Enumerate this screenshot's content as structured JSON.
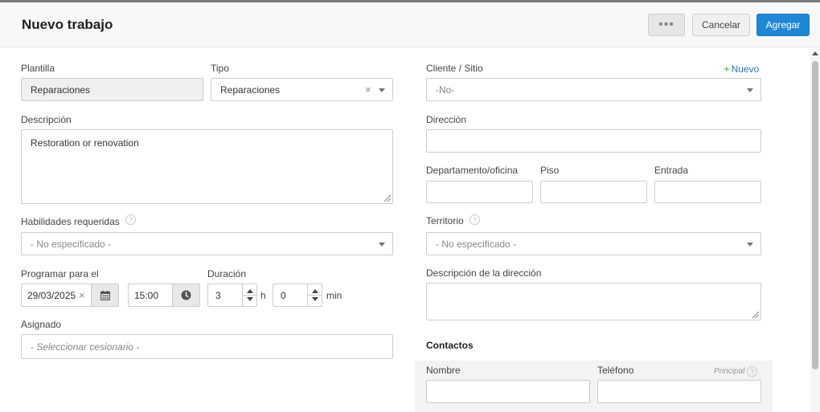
{
  "header": {
    "title": "Nuevo trabajo",
    "more_label": "•••",
    "cancel_label": "Cancelar",
    "add_label": "Agregar"
  },
  "form": {
    "plantilla": {
      "label": "Plantilla",
      "value": "Reparaciones"
    },
    "tipo": {
      "label": "Tipo",
      "value": "Reparaciones"
    },
    "descripcion": {
      "label": "Descripción",
      "value": "Restoration or renovation"
    },
    "habilidades": {
      "label": "Habilidades requeridas",
      "placeholder": "- No especificado -"
    },
    "programar": {
      "label": "Programar para el",
      "date": "29/03/2025",
      "time": "15:00"
    },
    "duracion": {
      "label": "Duración",
      "hours": "3",
      "hours_unit": "h",
      "minutes": "0",
      "minutes_unit": "min"
    },
    "asignado": {
      "label": "Asignado",
      "placeholder": "- Seleccionar cesionario -"
    },
    "cliente": {
      "label": "Cliente / Sitio",
      "new_label": "Nuevo",
      "value": "-No-"
    },
    "direccion": {
      "label": "Dirección",
      "value": ""
    },
    "departamento": {
      "label": "Departamento/oficina",
      "value": ""
    },
    "piso": {
      "label": "Piso",
      "value": ""
    },
    "entrada": {
      "label": "Entrada",
      "value": ""
    },
    "territorio": {
      "label": "Territorio",
      "placeholder": "- No especificado -"
    },
    "descripcion_direccion": {
      "label": "Descripción de la dirección",
      "value": ""
    }
  },
  "contactos": {
    "title": "Contactos",
    "nombre_label": "Nombre",
    "telefono_label": "Teléfono",
    "principal_label": "Principal"
  },
  "icons": {
    "clear": "×",
    "help": "?",
    "plus": "+"
  },
  "colors": {
    "accent": "#1e87d6",
    "link": "#2a7ab8",
    "new_plus": "#3aa84a"
  }
}
